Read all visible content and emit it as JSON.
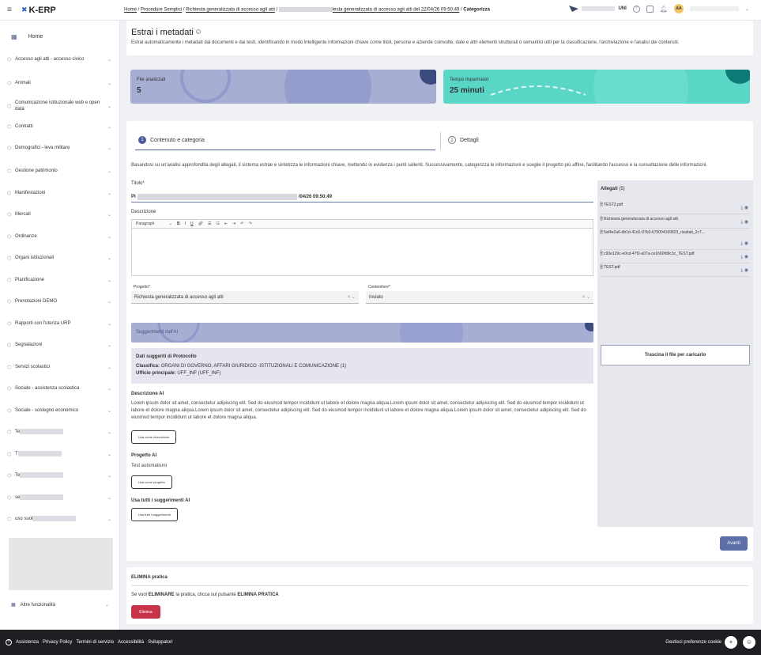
{
  "app": {
    "logo": "K-ERP"
  },
  "breadcrumb": {
    "home": "Home",
    "proc": "Procedure Semplici",
    "req": "Richiesta generalizzata di accesso agli atti",
    "item": "iesta generalizzata di accesso agli atti del 22/04/26 09:50:49",
    "current": "Categorizza"
  },
  "topbar": {
    "unit": "UNI",
    "avatar": "AA"
  },
  "sidebar": {
    "home": "Home",
    "items": [
      {
        "label": "Accesso agli atti - accesso civico",
        "redacted": false
      },
      {
        "label": "Animali",
        "redacted": false
      },
      {
        "label": "Comunicazione istituzionale web e open data",
        "redacted": false
      },
      {
        "label": "Contratti",
        "redacted": false
      },
      {
        "label": "Demografici - leva militare",
        "redacted": false
      },
      {
        "label": "Gestione patrimonio",
        "redacted": false
      },
      {
        "label": "Manifestazioni",
        "redacted": false
      },
      {
        "label": "Mercati",
        "redacted": false
      },
      {
        "label": "Ordinanze",
        "redacted": false
      },
      {
        "label": "Organi istituzionali",
        "redacted": false
      },
      {
        "label": "Pianificazione",
        "redacted": false
      },
      {
        "label": "Prenotazioni DEMO",
        "redacted": false
      },
      {
        "label": "Rapporti con l'utenza URP",
        "redacted": false
      },
      {
        "label": "Segnalazioni",
        "redacted": false
      },
      {
        "label": "Servizi scolastici",
        "redacted": false
      },
      {
        "label": "Sociale - assistenza scolastica",
        "redacted": false
      },
      {
        "label": "Sociale - sostegno economico",
        "redacted": false
      },
      {
        "label": "Te",
        "redacted": true
      },
      {
        "label": "T",
        "redacted": true
      },
      {
        "label": "Te",
        "redacted": true
      },
      {
        "label": "se",
        "redacted": true
      },
      {
        "label": "uso suol",
        "redacted": true
      }
    ],
    "altre": "Altre funzionalità"
  },
  "header": {
    "title": "Estrai i metadati",
    "description": "Estrai automaticamente i metadati dai documenti e dai testi, identificando in modo intelligente informazioni chiave come titoli, persone e aziende coinvolte, date e altri elementi strutturali o semantici utili per la classificazione, l'archiviazione e l'analisi dei contenuti."
  },
  "stats": [
    {
      "label": "File analizzati",
      "value": "5",
      "color": "#a6aed4"
    },
    {
      "label": "Tempo risparmiato",
      "value": "25 minuti",
      "color": "#5ad6c6"
    }
  ],
  "steps": [
    {
      "num": "1",
      "label": "Contenuto e categoria"
    },
    {
      "num": "2",
      "label": "Dettagli"
    }
  ],
  "intro": "Basandosi su un'analisi approfondita degli allegati, il sistema estrae e sintetizza le informazioni chiave, mettendo in evidenza i punti salienti. Successivamente, categorizza le informazioni e sceglie il progetto più affine, facilitando l'accesso e la consultazione delle informazioni.",
  "form": {
    "titolo_label": "Titolo*",
    "titolo_prefix": "Pl",
    "titolo_suffix": "/04/26 09:50:49",
    "descrizione_label": "Descrizione",
    "paragraph": "Paragraph",
    "progetto_label": "Progetto*",
    "progetto_value": "Richiesta generalizzata di accesso agli atti",
    "contenitore_label": "Contenitore*",
    "contenitore_value": "Inviato"
  },
  "ai": {
    "banner": "Suggerimenti dall'AI",
    "protocollo_title": "Dati suggeriti di Protocollo",
    "classifica_label": "Classifica:",
    "classifica_value": "ORGANI DI GOVERNO, AFFARI GIURIDICO -ISTITUZIONALI E COMUNICAZIONE (1)",
    "ufficio_label": "Ufficio principale:",
    "ufficio_value": "UFF_INF (UFF_INF)",
    "descrizione_title": "Descrizione AI",
    "descrizione_text": "Lorem ipsum dolor sit amet, consectetur adipiscing elit. Sed do eiusmod tempor incididunt ut labore et dolore magna aliqua.Lorem ipsum dolor sit amet, consectetur adipiscing elit. Sed do eiusmod tempor incididunt ut labore et dolore magna aliqua.Lorem ipsum dolor sit amet, consectetur adipiscing elit. Sed do eiusmod tempor incididunt ut labore et dolore magna aliqua.Lorem ipsum dolor sit amet, consectetur adipiscing elit. Sed do eiusmod tempor incididunt ut labore et dolore magna aliqua.",
    "usa_descrizione": "Usa come descrizione",
    "progetto_title": "Progetto AI",
    "progetto_value": "Test automatismi",
    "usa_progetto": "Usa come progetto",
    "tutti_title": "Usa tutti i suggerimenti AI",
    "usa_tutti": "Usa tutti i suggerimenti"
  },
  "allegati": {
    "title": "Allegati",
    "count": "(5)",
    "files": [
      "TEST2.pdf",
      "Richiesta generalizzata di accesso agli atti",
      "5af4e2a6-db1d-41d1-97b3-675004169823_risultati_2c7...",
      "c93e129c-e0cd-47f2-a07a-ce1660fd9c3c_TEST.pdf",
      "TEST.pdf"
    ],
    "drop": "Trascina il file per caricarlo"
  },
  "avanti": "Avanti",
  "elimina": {
    "title": "ELIMINA pratica",
    "text_pre": "Se vuoi ",
    "text_bold": "ELIMINARE",
    "text_mid": " la pratica, clicca sul pulsante ",
    "text_bold2": "ELIMINA PRATICA",
    "button": "Elimina"
  },
  "footer": {
    "links": [
      "Assistenza",
      "Privacy Policy",
      "Termini di servizio",
      "Accessibilità",
      "Sviluppatori"
    ],
    "cookie": "Gestisci preferenze cookie"
  }
}
